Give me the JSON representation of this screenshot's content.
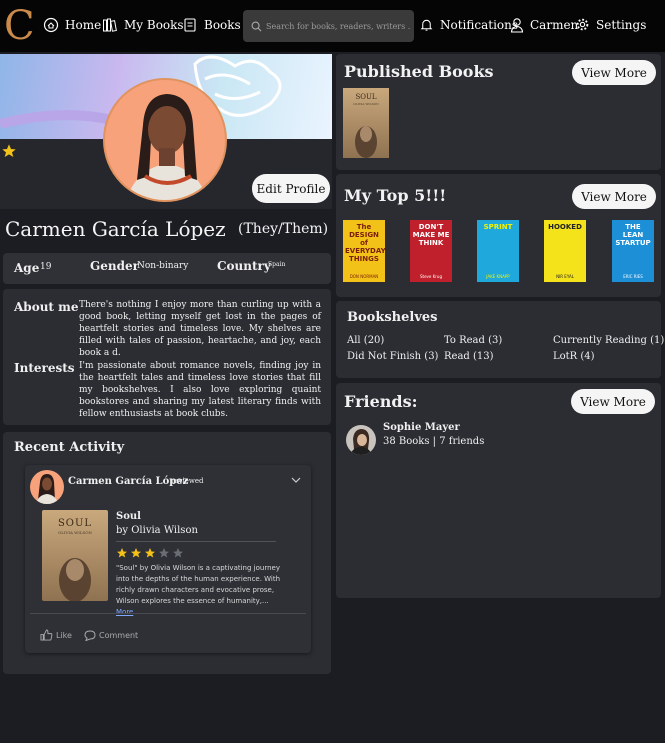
{
  "nav": {
    "logo": "C",
    "home": "Home",
    "my_books": "My Books",
    "books": "Books",
    "search_placeholder": "Search for books, readers, writers . . .",
    "notifications": "Notifications",
    "user": "Carmen",
    "settings": "Settings"
  },
  "profile": {
    "name": "Carmen García López",
    "pronouns": "(They/Them)",
    "edit_label": "Edit Profile",
    "age_label": "Age",
    "age": "19",
    "gender_label": "Gender",
    "gender": "Non-binary",
    "country_label": "Country",
    "country": "Spain",
    "about_label": "About me",
    "about": "There's nothing I enjoy more than curling up with a good book, letting myself get lost in the pages of heartfelt stories and timeless love. My shelves are filled with tales of passion, heartache, and joy, each book a d.",
    "interests_label": "Interests",
    "interests": "I'm passionate about romance novels, finding joy in the heartfelt tales and timeless love stories that fill my bookshelves. I also love exploring quaint bookstores and sharing my latest literary finds with fellow enthusiasts at book clubs."
  },
  "activity": {
    "title": "Recent Activity",
    "user": "Carmen García López",
    "action": "reviewed",
    "book_title": "Soul",
    "book_author": "by Olivia Wilson",
    "cover_title": "SOUL",
    "cover_author": "OLIVIA WILSON",
    "rating": 3,
    "review": "\"Soul\" by Olivia Wilson is a captivating journey into the depths of the human experience. With richly drawn characters and evocative prose, Wilson explores the essence of humanity,...",
    "more": "More",
    "like": "Like",
    "comment": "Comment"
  },
  "published": {
    "title": "Published Books",
    "view_more": "View More",
    "cover_title": "SOUL",
    "cover_author": "OLIVIA WILSON"
  },
  "top5": {
    "title": "My Top 5!!!",
    "view_more": "View More",
    "books": [
      {
        "title": "The DESIGN of EVERYDAY THINGS",
        "author": "DON NORMAN",
        "bg": "#f2c218",
        "fg": "#7a1e0b"
      },
      {
        "title": "DON'T MAKE ME THINK",
        "author": "Steve Krug",
        "bg": "#c0202b",
        "fg": "#ffffff"
      },
      {
        "title": "SPRINT",
        "author": "JAKE KNAPP",
        "bg": "#1fa8dc",
        "fg": "#f2f200"
      },
      {
        "title": "HOOKED",
        "author": "NIR EYAL",
        "bg": "#f4e21a",
        "fg": "#222222"
      },
      {
        "title": "THE LEAN STARTUP",
        "author": "ERIC RIES",
        "bg": "#1d8fd6",
        "fg": "#ffffff"
      }
    ]
  },
  "bookshelves": {
    "title": "Bookshelves",
    "items": [
      "All (20)",
      "To Read (3)",
      "Currently Reading (1)",
      "Did Not Finish (3)",
      "Read (13)",
      "LotR (4)"
    ]
  },
  "friends": {
    "title": "Friends:",
    "view_more": "View More",
    "list": [
      {
        "name": "Sophie Mayer",
        "stats": "38 Books | 7 friends"
      }
    ]
  },
  "colors": {
    "accent": "#c98a4b",
    "panel": "#2b2d33",
    "bg": "#1c1d22",
    "star": "#f2c218"
  }
}
